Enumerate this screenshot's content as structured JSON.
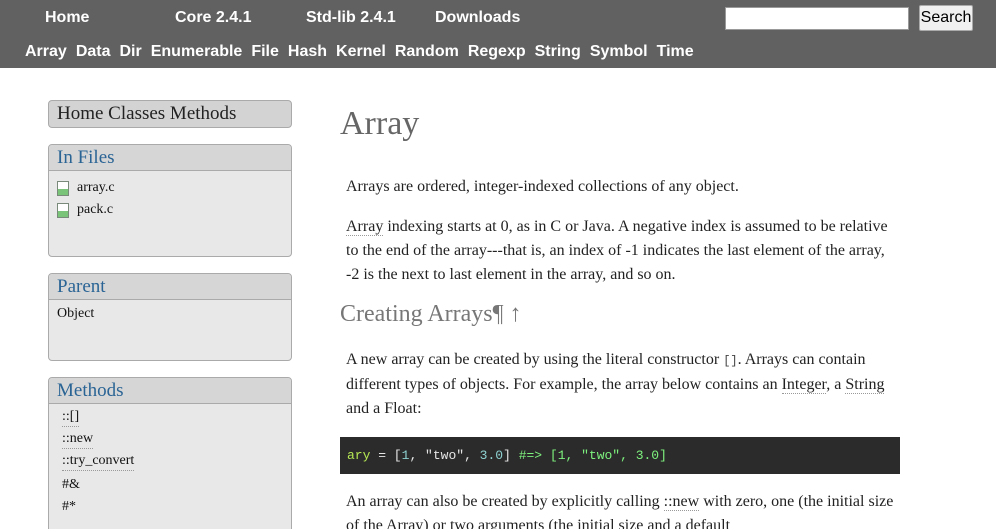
{
  "topnav": {
    "home": "Home",
    "core": "Core 2.4.1",
    "stdlib": "Std-lib 2.4.1",
    "downloads": "Downloads"
  },
  "search": {
    "placeholder": "",
    "button": "Search"
  },
  "classnav": [
    "Array",
    "Data",
    "Dir",
    "Enumerable",
    "File",
    "Hash",
    "Kernel",
    "Random",
    "Regexp",
    "String",
    "Symbol",
    "Time"
  ],
  "sidebar": {
    "homebar": "Home Classes Methods",
    "in_files": {
      "title": "In Files",
      "files": [
        "array.c",
        "pack.c"
      ]
    },
    "parent": {
      "title": "Parent",
      "value": "Object"
    },
    "methods": {
      "title": "Methods",
      "items": [
        "::[]",
        "::new",
        "::try_convert",
        "#&",
        "#*"
      ]
    }
  },
  "main": {
    "title": "Array",
    "p1": "Arrays are ordered, integer-indexed collections of any object.",
    "p2_word": "Array",
    "p2_rest": " indexing starts at 0, as in C or Java. A negative index is assumed to be relative to the end of the array---that is, an index of -1 indicates the last element of the array, -2 is the next to last element in the array, and so on.",
    "section1": "Creating Arrays¶ ↑",
    "p3_a": "A new array can be created by using the literal constructor ",
    "p3_code": "[]",
    "p3_b": ". Arrays can contain different types of objects. For example, the array below contains an ",
    "p3_integer": "Integer",
    "p3_c": ", a ",
    "p3_string": "String",
    "p3_d": " and a Float:",
    "code": {
      "var": "ary",
      "eq": " = [",
      "n1": "1",
      "sep1": ", ",
      "s1": "\"two\"",
      "sep2": ", ",
      "n2": "3.0",
      "close": "] ",
      "comment": "#=> [1, \"two\", 3.0]"
    },
    "p4_a": "An array can also be created by explicitly calling ",
    "p4_new": "::new",
    "p4_b": " with zero, one (the initial size of the Array) or two arguments (the initial size and a default"
  }
}
